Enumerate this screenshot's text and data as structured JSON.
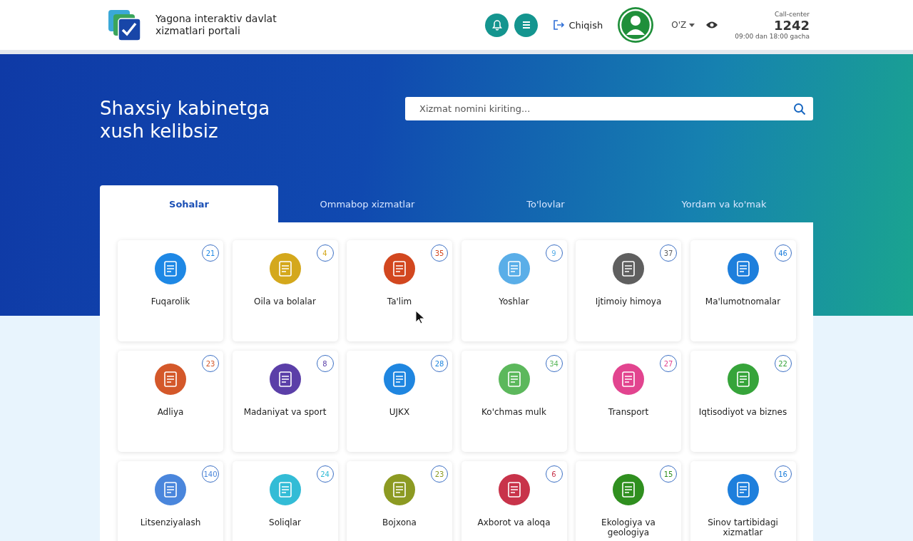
{
  "header": {
    "portal_name": "Yagona interaktiv davlat xizmatlari portali",
    "logout": "Chiqish",
    "language": "O'Z",
    "call_center": {
      "label": "Call-center",
      "number": "1242",
      "hours": "09:00 dan 18:00 gacha"
    }
  },
  "hero": {
    "greeting": "Shaxsiy kabinetga xush kelibsiz",
    "search": {
      "placeholder": "Xizmat nomini kiriting..."
    }
  },
  "tabs": [
    {
      "label": "Sohalar",
      "selected": true
    },
    {
      "label": "Ommabop xizmatlar",
      "selected": false
    },
    {
      "label": "To'lovlar",
      "selected": false
    },
    {
      "label": "Yordam va ko'mak",
      "selected": false
    }
  ],
  "categories": [
    {
      "name": "Fuqarolik",
      "count": "21",
      "color": "#1e88e5"
    },
    {
      "name": "Oila va bolalar",
      "count": "4",
      "color": "#d4a81c"
    },
    {
      "name": "Ta'lim",
      "count": "35",
      "color": "#d2471f"
    },
    {
      "name": "Yoshlar",
      "count": "9",
      "color": "#5aaee8"
    },
    {
      "name": "Ijtimoiy himoya",
      "count": "37",
      "color": "#5f5f5f"
    },
    {
      "name": "Ma'lumotnomalar",
      "count": "46",
      "color": "#1e7fdc"
    },
    {
      "name": "Adliya",
      "count": "23",
      "color": "#d4582a"
    },
    {
      "name": "Madaniyat va sport",
      "count": "8",
      "color": "#5b3fa8"
    },
    {
      "name": "UJKX",
      "count": "28",
      "color": "#1f86e0"
    },
    {
      "name": "Ko'chmas mulk",
      "count": "34",
      "color": "#5cb85c"
    },
    {
      "name": "Transport",
      "count": "27",
      "color": "#e2448f"
    },
    {
      "name": "Iqtisodiyot va biznes",
      "count": "22",
      "color": "#36a43a"
    },
    {
      "name": "Litsenziyalash",
      "count": "140",
      "color": "#4a86dc"
    },
    {
      "name": "Soliqlar",
      "count": "24",
      "color": "#33bcd6"
    },
    {
      "name": "Bojxona",
      "count": "23",
      "color": "#8c9a22"
    },
    {
      "name": "Axborot va aloqa",
      "count": "6",
      "color": "#c8334a"
    },
    {
      "name": "Ekologiya va geologiya",
      "count": "15",
      "color": "#2f8f1f"
    },
    {
      "name": "Sinov tartibidagi xizmatlar",
      "count": "16",
      "color": "#1e7fdc"
    }
  ]
}
